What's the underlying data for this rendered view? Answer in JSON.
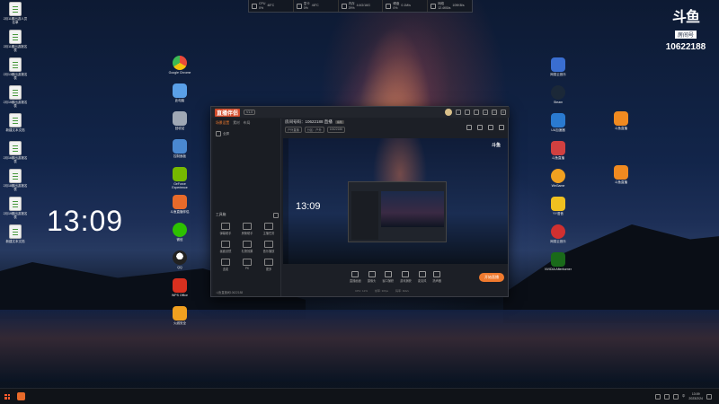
{
  "perf": [
    {
      "icon": "cpu-icon",
      "name": "CPU",
      "line1": "0%",
      "line2": "48°C"
    },
    {
      "icon": "gpu-icon",
      "name": "显卡",
      "line1": "0%",
      "line2": "48°C"
    },
    {
      "icon": "memory-icon",
      "name": "内存",
      "line1": "29%",
      "line2": "4.6G/16G"
    },
    {
      "icon": "disk-icon",
      "name": "硬盘",
      "line1": "0%",
      "line2": "0.1M/s"
    },
    {
      "icon": "network-icon",
      "name": "网络",
      "line1": "12.4KB/s",
      "line2": "109KB/s"
    }
  ],
  "douyu": {
    "logo": "斗鱼",
    "label": "房间号",
    "room": "10622188"
  },
  "clock": "13:09",
  "desktop_left": [
    {
      "label": "2月11期出游人员名单"
    },
    {
      "label": "2月11期出游报名表"
    },
    {
      "label": "2月13期出游报名表"
    },
    {
      "label": "2月15期出游报名表"
    },
    {
      "label": "新建文本文档"
    },
    {
      "label": "2月16期出游报名表"
    },
    {
      "label": "2月18期出游报名表"
    },
    {
      "label": "2月19期出游报名表"
    },
    {
      "label": "新建文本文档"
    }
  ],
  "desktop_mid": [
    {
      "label": "Google Chrome",
      "color": "#e84a3a"
    },
    {
      "label": "此电脑",
      "color": "#5aa0e8"
    },
    {
      "label": "回收站",
      "color": "#9fa8b5"
    },
    {
      "label": "控制面板",
      "color": "#4a88d0"
    },
    {
      "label": "GeForce Experience",
      "color": "#76b900"
    },
    {
      "label": "斗鱼直播伴侣",
      "color": "#e86a2a"
    },
    {
      "label": "微信",
      "color": "#2dc100"
    },
    {
      "label": "QQ",
      "color": "#222222"
    },
    {
      "label": "WPS Office",
      "color": "#d9301f"
    },
    {
      "label": "火绒安全",
      "color": "#f0a020"
    }
  ],
  "desktop_right": [
    {
      "label": "网易云音乐",
      "color": "#3a6ed0"
    },
    {
      "label": "Steam",
      "color": "#1b2838"
    },
    {
      "label": "UU加速器",
      "color": "#2a7ad0"
    },
    {
      "label": "斗鱼直播",
      "color": "#d04040"
    },
    {
      "label": "WeGame",
      "color": "#f0a020"
    },
    {
      "label": "YY语音",
      "color": "#f0c020"
    },
    {
      "label": "网易云音乐",
      "color": "#d03030"
    },
    {
      "label": "NVIDIA Afterburner",
      "color": "#1a6a1a"
    }
  ],
  "desktop_far_right": [
    {
      "label": "斗鱼直播",
      "color": "#f08a20"
    },
    {
      "label": "斗鱼直播",
      "color": "#f08a20"
    }
  ],
  "app": {
    "logo": "直播伴侣",
    "version": "V1.0",
    "tabs": [
      "场景设置",
      "素材",
      "布局"
    ],
    "scene_label": "全屏",
    "tools_header": "工具箱",
    "tools": [
      "弹幕助手",
      "房管助手",
      "主播任务",
      "画面滤镜",
      "礼物效果",
      "音乐播放",
      "连麦",
      "PK",
      "更多"
    ],
    "footer": "斗鱼直播间10622188",
    "stream_title": "房间号码：10622188 直播",
    "stream_badge": "编辑",
    "stream_tags": [
      "户外直播",
      "分区：户外",
      "10622188"
    ],
    "bottom_actions": [
      "直播画面",
      "摄像头",
      "窗口捕获",
      "游戏捕获",
      "麦克风",
      "扬声器"
    ],
    "go_live": "开始直播",
    "status": [
      "CPU: 12%",
      "帧率: 30fps",
      "码率: 0kb/s"
    ]
  },
  "taskbar": {
    "tray_lang": "中",
    "time": "13:09",
    "date": "2023/2/24"
  }
}
